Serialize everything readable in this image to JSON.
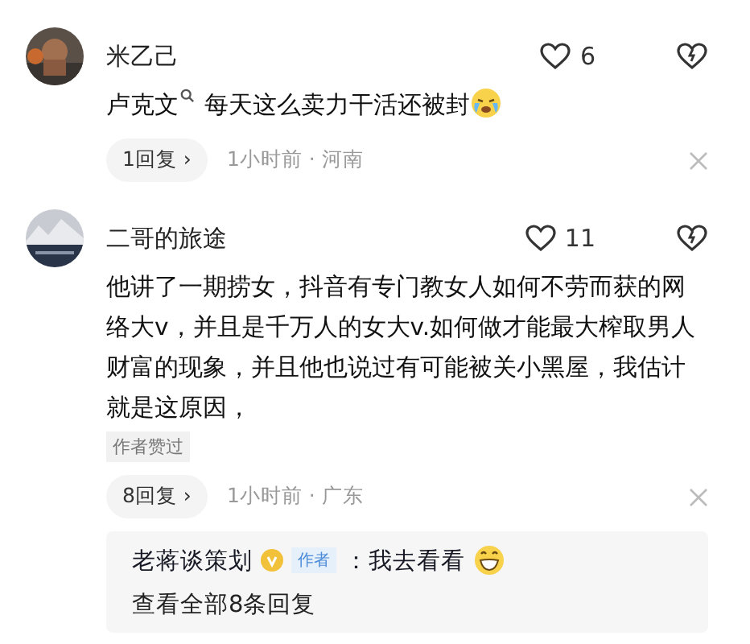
{
  "comments": [
    {
      "author": "米乙己",
      "likes": "6",
      "keyword": "卢克文",
      "text": "每天这么卖力干活还被封",
      "crying_emoji": true,
      "replies_label": "1回复 ›",
      "time": "1小时前 · 河南"
    },
    {
      "author": "二哥的旅途",
      "likes": "11",
      "text": "他讲了一期捞女，抖音有专门教女人如何不劳而获的网络大v，并且是千万人的女大v.如何做才能最大榨取男人财富的现象，并且他也说过有可能被关小黑屋，我估计就是这原因，",
      "badge": "作者赞过",
      "replies_label": "8回复 ›",
      "time": "1小时前 · 广东",
      "reply_preview": {
        "author": "老蒋谈策划",
        "verified": true,
        "role": "作者",
        "text": "：我去看看",
        "laughing_emoji": true,
        "view_all": "查看全部8条回复"
      }
    }
  ]
}
